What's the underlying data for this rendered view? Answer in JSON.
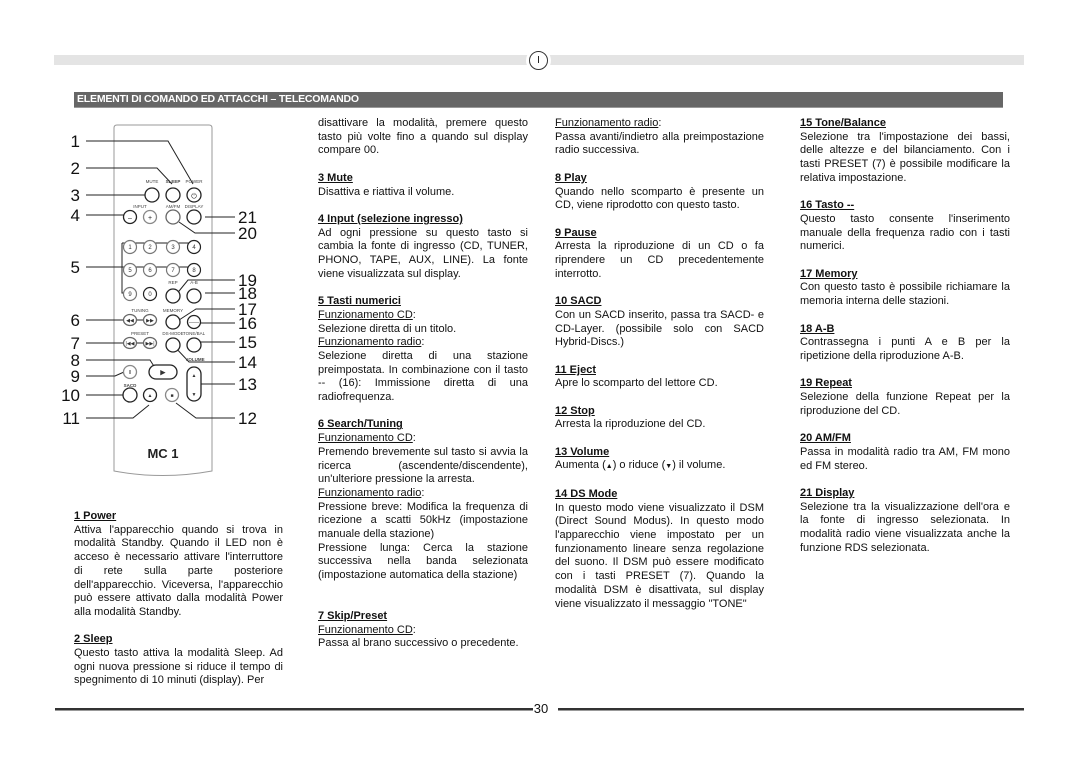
{
  "header": {
    "language_badge": "I",
    "section_title": "ELEMENTI DI COMANDO ED ATTACCHI – TELECOMANDO"
  },
  "remote": {
    "model": "MC 1",
    "button_labels": {
      "mute": "MUTE",
      "sleep": "SLEEP",
      "power": "POWER",
      "input": "INPUT",
      "amfm": "AM/FM",
      "display": "DISPLAY",
      "rep": "REP",
      "ab": "A-B",
      "tuning": "TUNING",
      "memory": "MEMORY",
      "preset": "PRESET",
      "dsmode": "DS-MODE",
      "tonebal": "TONE/BAL",
      "volume": "VOLUME",
      "sacd": "SACD"
    },
    "digits": [
      "1",
      "2",
      "3",
      "4",
      "5",
      "6",
      "7",
      "8",
      "9",
      "0"
    ],
    "callouts_left": [
      "1",
      "2",
      "3",
      "4",
      "5",
      "6",
      "7",
      "8",
      "9",
      "10",
      "11"
    ],
    "callouts_right": [
      "21",
      "20",
      "19",
      "18",
      "17",
      "16",
      "15",
      "14",
      "13",
      "12"
    ]
  },
  "col1": {
    "s1_title": "1 Power",
    "s1_text": "Attiva l'apparecchio quando si trova in modalità Standby. Quando il LED non è acceso è necessario attivare l'interruttore di rete sulla parte posteriore dell'apparecchio. Viceversa, l'apparecchio può essere attivato dalla modalità Power alla modalità Standby.",
    "s2_title": "2  Sleep",
    "s2_text": "Questo tasto attiva la modalità Sleep. Ad ogni nuova pressione si riduce il tempo di spegnimento di 10 minuti (display). Per"
  },
  "col2": {
    "s2_cont": "disattivare la modalità, premere questo tasto più volte fino a quando sul display compare 00.",
    "s3_title": "3  Mute",
    "s3_text": "Disattiva e riattiva il volume.",
    "s4_title": "4  Input (selezione ingresso)",
    "s4_text": "Ad ogni pressione su questo tasto si cambia la fonte di ingresso (CD, TUNER, PHONO, TAPE, AUX, LINE). La fonte viene visualizzata sul display.",
    "s5_title": "5  Tasti numerici",
    "s5_cd_label": "Funzionamento CD",
    "s5_cd_text": "Selezione diretta di un titolo.",
    "s5_radio_label": "Funzionamento radio",
    "s5_radio_text": "Selezione diretta di una stazione preimpostata. In combinazione con il tasto -- (16): Immissione diretta di una radiofrequenza.",
    "s6_title": "6  Search/Tuning",
    "s6_cd_label": "Funzionamento CD",
    "s6_cd_text": "Premendo brevemente sul tasto si avvia la ricerca (ascendente/discendente), un'ulteriore pressione la arresta.",
    "s6_radio_label": "Funzionamento radio",
    "s6_radio_text1": "Pressione breve: Modifica la frequenza di ricezione a scatti 50kHz (impostazione manuale della stazione)",
    "s6_radio_text2": "Pressione lunga: Cerca la stazione successiva nella banda selezionata (impostazione automatica della stazione)",
    "s7_title": "7  Skip/Preset",
    "s7_cd_label": "Funzionamento CD",
    "s7_cd_text": "Passa al brano successivo o precedente."
  },
  "col3": {
    "s7_radio_label": "Funzionamento radio",
    "s7_radio_text": "Passa avanti/indietro alla preimpostazione radio successiva.",
    "s8_title": "8  Play",
    "s8_text": "Quando nello scomparto è presente un CD, viene riprodotto con questo tasto.",
    "s9_title": "9  Pause",
    "s9_text": "Arresta la riproduzione di un CD o fa riprendere un CD precedentemente interrotto.",
    "s10_title": "10  SACD",
    "s10_text": "Con un SACD inserito, passa tra SACD- e CD-Layer. (possibile solo con SACD Hybrid-Discs.)",
    "s11_title": "11  Eject",
    "s11_text": "Apre lo scomparto del lettore CD.",
    "s12_title": "12  Stop",
    "s12_text": "Arresta la riproduzione del CD.",
    "s13_title": "13  Volume",
    "s13_text_a": "Aumenta (",
    "s13_up": "▲",
    "s13_text_b": ") o riduce (",
    "s13_down": "▼",
    "s13_text_c": ") il volume.",
    "s14_title": "14  DS Mode",
    "s14_text": "In questo modo viene visualizzato il DSM (Direct Sound Modus). In questo modo l'apparecchio viene impostato per un funzionamento lineare senza regolazione del suono. Il DSM può essere modificato con i tasti PRESET (7). Quando la modalità DSM è disattivata, sul display viene visualizzato il messaggio \"TONE\""
  },
  "col4": {
    "s15_title": "15 Tone/Balance",
    "s15_text": "Selezione tra l'impostazione dei bassi, delle altezze e del bilanciamento. Con i tasti PRESET (7) è possibile modificare la relativa impostazione.",
    "s16_title": "16  Tasto --",
    "s16_text": "Questo tasto consente l'inserimento manuale della frequenza radio con i tasti numerici.",
    "s17_title": "17  Memory",
    "s17_text": "Con questo tasto è possibile richiamare la memoria interna delle stazioni.",
    "s18_title": "18  A-B",
    "s18_text": "Contrassegna i punti A e B per la ripetizione della riproduzione A-B.",
    "s19_title": "19  Repeat",
    "s19_text": "Selezione della funzione Repeat per la riproduzione del CD.",
    "s20_title": "20  AM/FM",
    "s20_text": "Passa in modalità radio tra AM, FM mono ed FM stereo.",
    "s21_title": "21 Display",
    "s21_text": "Selezione tra la visualizzazione dell'ora e la fonte di ingresso selezionata. In modalità radio viene visualizzata anche la funzione RDS selezionata."
  },
  "footer": {
    "page_number": "30"
  }
}
